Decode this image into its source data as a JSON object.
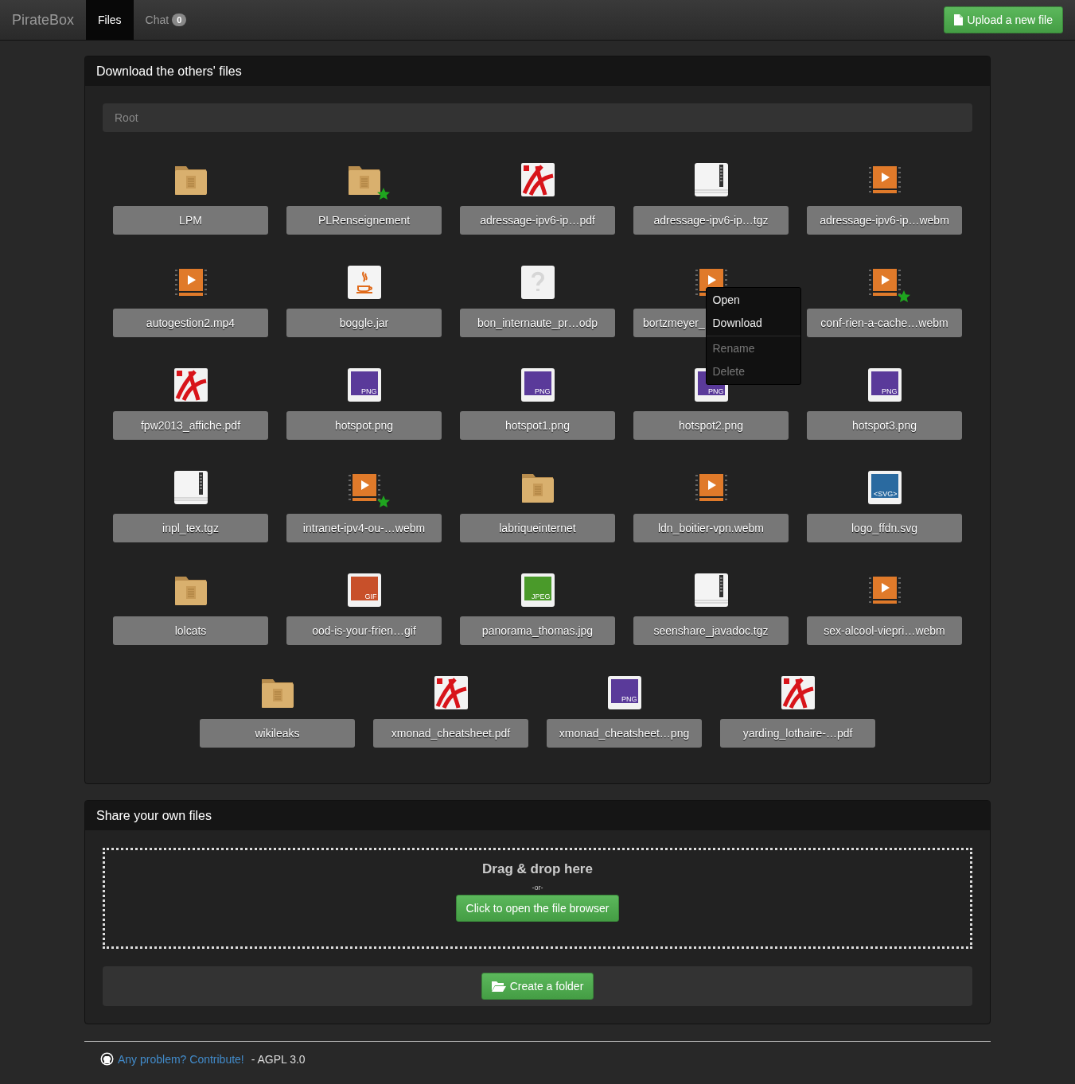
{
  "navbar": {
    "brand": "PirateBox",
    "tabs": [
      {
        "label": "Files",
        "selected": true
      },
      {
        "label": "Chat",
        "selected": false,
        "badge": "0"
      }
    ],
    "upload_button": "Upload a new file"
  },
  "download_panel": {
    "title": "Download the others' files",
    "breadcrumb": "Root",
    "files": [
      {
        "name": "LPM",
        "kind": "folder",
        "starred": false
      },
      {
        "name": "PLRenseignement",
        "kind": "folder",
        "starred": true
      },
      {
        "name": "adressage-ipv6-ip…pdf",
        "kind": "pdf",
        "starred": false
      },
      {
        "name": "adressage-ipv6-ip…tgz",
        "kind": "archive",
        "starred": false
      },
      {
        "name": "adressage-ipv6-ip…webm",
        "kind": "video",
        "starred": false
      },
      {
        "name": "autogestion2.mp4",
        "kind": "video",
        "starred": false
      },
      {
        "name": "boggle.jar",
        "kind": "java",
        "starred": false
      },
      {
        "name": "bon_internaute_pr…odp",
        "kind": "unknown",
        "starred": false
      },
      {
        "name": "bortzmeyer_",
        "kind": "video",
        "starred": false
      },
      {
        "name": "conf-rien-a-cache…webm",
        "kind": "video",
        "starred": true
      },
      {
        "name": "fpw2013_affiche.pdf",
        "kind": "pdf",
        "starred": false
      },
      {
        "name": "hotspot.png",
        "kind": "image",
        "badge": "PNG",
        "color": "#5a3a9a",
        "starred": false
      },
      {
        "name": "hotspot1.png",
        "kind": "image",
        "badge": "PNG",
        "color": "#5a3a9a",
        "starred": false
      },
      {
        "name": "hotspot2.png",
        "kind": "image",
        "badge": "PNG",
        "color": "#5a3a9a",
        "starred": false
      },
      {
        "name": "hotspot3.png",
        "kind": "image",
        "badge": "PNG",
        "color": "#5a3a9a",
        "starred": false
      },
      {
        "name": "inpl_tex.tgz",
        "kind": "archive",
        "starred": false
      },
      {
        "name": "intranet-ipv4-ou-…webm",
        "kind": "video",
        "starred": true
      },
      {
        "name": "labriqueinternet",
        "kind": "folder",
        "starred": false
      },
      {
        "name": "ldn_boitier-vpn.webm",
        "kind": "video",
        "starred": false
      },
      {
        "name": "logo_ffdn.svg",
        "kind": "image",
        "badge": "<SVG>",
        "color": "#2a6aa0",
        "starred": false
      },
      {
        "name": "lolcats",
        "kind": "folder",
        "starred": false
      },
      {
        "name": "ood-is-your-frien…gif",
        "kind": "image",
        "badge": "GIF",
        "color": "#c8502a",
        "starred": false
      },
      {
        "name": "panorama_thomas.jpg",
        "kind": "image",
        "badge": "JPEG",
        "color": "#4a9a2a",
        "starred": false
      },
      {
        "name": "seenshare_javadoc.tgz",
        "kind": "archive",
        "starred": false
      },
      {
        "name": "sex-alcool-viepri…webm",
        "kind": "video",
        "starred": false
      },
      {
        "name": "wikileaks",
        "kind": "folder",
        "starred": false
      },
      {
        "name": "xmonad_cheatsheet.pdf",
        "kind": "pdf",
        "starred": false
      },
      {
        "name": "xmonad_cheatsheet…png",
        "kind": "image",
        "badge": "PNG",
        "color": "#5a3a9a",
        "starred": false
      },
      {
        "name": "yarding_lothaire-…pdf",
        "kind": "pdf",
        "starred": false
      }
    ],
    "context_menu": {
      "items": [
        {
          "label": "Open",
          "disabled": false
        },
        {
          "label": "Download",
          "disabled": false
        },
        {
          "label": "Rename",
          "disabled": true
        },
        {
          "label": "Delete",
          "disabled": true
        }
      ]
    }
  },
  "share_panel": {
    "title": "Share your own files",
    "drop_title": "Drag & drop here",
    "or": "-or-",
    "browse_button": "Click to open the file browser",
    "create_folder_button": "Create a folder"
  },
  "footer": {
    "link": "Any problem? Contribute!",
    "license": " - AGPL 3.0"
  }
}
